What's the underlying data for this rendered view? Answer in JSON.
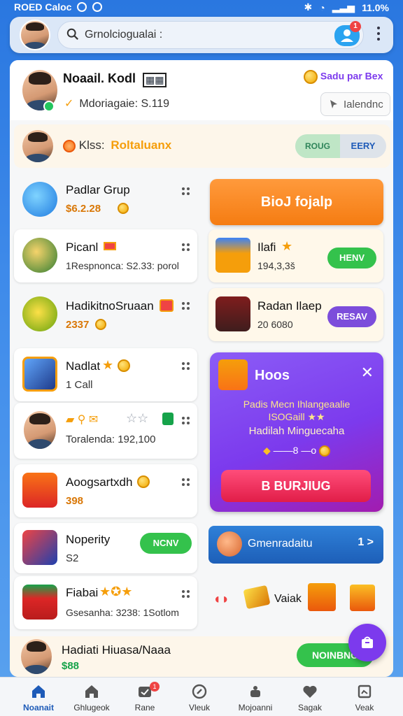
{
  "status_bar": {
    "carrier": "ROED Caloc",
    "battery": "11.0%"
  },
  "topbar": {
    "search_placeholder": "Grnolciogualai :",
    "notification_count": "1"
  },
  "profile": {
    "name": "Noaail. Kodl",
    "subtitle": "Mdoriagaie: S.119",
    "rewards_label": "Sadu par Bex",
    "leaderboard_label": "Ialendnc"
  },
  "group_bar": {
    "label": "Klss:",
    "label_accent": "Roltaluanx",
    "seg_a": "ROUG",
    "seg_b": "EERY"
  },
  "left_items": [
    {
      "title": "Padlar Grup",
      "value": "$6.2.28"
    },
    {
      "title": "Picanl",
      "value": "1Respnonca: S2.33: porol"
    },
    {
      "title": "HadikitnoSruaan",
      "value": "2337"
    },
    {
      "title": "Nadlat",
      "value": "1 Саll"
    },
    {
      "title": "",
      "value": "Toralenda: 192,100"
    },
    {
      "title": "Aoogsartхdh",
      "value": "398"
    },
    {
      "title": "Noperity",
      "value": "S2",
      "button": "NCNV"
    },
    {
      "title": "Fiabai",
      "value": "Gsesanha: 3238: 1Sotlom"
    }
  ],
  "right_items": {
    "cta_orange": "BioJ fojalp",
    "card1": {
      "title": "Ilafi",
      "value": "194,3,3š",
      "button": "HENV"
    },
    "card2": {
      "title": "Radan Ilaep",
      "value": "20 6080",
      "button": "RESAV"
    },
    "blue_bar": {
      "title": "Gmenradaitu",
      "right": "1 >"
    },
    "deco_label": "Vaiak"
  },
  "promo": {
    "title": "Hoos",
    "line1": "Padis Mecn Ihlangeaalie",
    "line2": "ISOGaill ★★",
    "line3": "Hadilah Minguecaha",
    "line4": "——8 —o",
    "cta": "В BURJIUG"
  },
  "last_bar": {
    "title": "Hadiatі Hiuasa/Naaa",
    "value": "$88",
    "button": "NOINBNO"
  },
  "navbar": [
    {
      "label": "Noanait",
      "active": true
    },
    {
      "label": "Ghlugeok"
    },
    {
      "label": "Rane",
      "badge": "1"
    },
    {
      "label": "Vleuk"
    },
    {
      "label": "Mojoanni"
    },
    {
      "label": "Sagak"
    },
    {
      "label": "Veak"
    }
  ]
}
